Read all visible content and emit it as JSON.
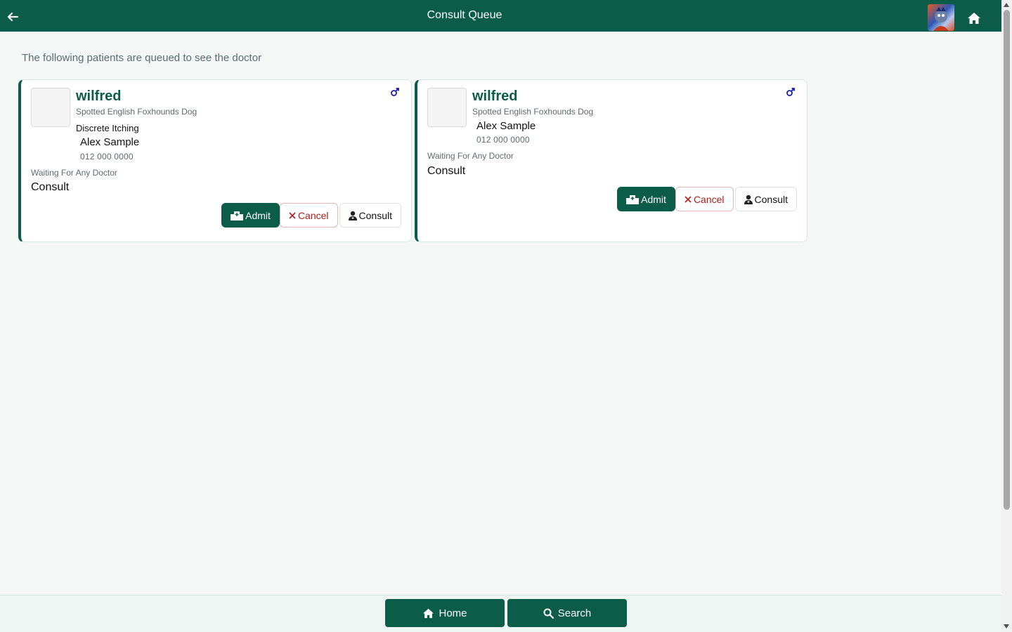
{
  "header": {
    "title": "Consult Queue"
  },
  "intro": "The following patients are queued to see the doctor",
  "cards": [
    {
      "pet_name": "wilfred",
      "breed": "Spotted English Foxhounds Dog",
      "complaint": "Discrete Itching",
      "owner": "Alex Sample",
      "phone": "012 000 0000",
      "waiting": "Waiting For Any Doctor",
      "consult_type": "Consult",
      "actions": {
        "admit": "Admit",
        "cancel": "Cancel",
        "consult": "Consult"
      }
    },
    {
      "pet_name": "wilfred",
      "breed": "Spotted English Foxhounds Dog",
      "complaint": "",
      "owner": "Alex Sample",
      "phone": "012 000 0000",
      "waiting": "Waiting For Any Doctor",
      "consult_type": "Consult",
      "actions": {
        "admit": "Admit",
        "cancel": "Cancel",
        "consult": "Consult"
      }
    }
  ],
  "bottom_nav": {
    "home": "Home",
    "search": "Search"
  },
  "colors": {
    "brand": "#0b5c48",
    "cancel": "#b01c1c",
    "male": "#1a1ab8"
  },
  "icons": [
    "back-arrow-icon",
    "home-icon",
    "male-icon",
    "hospital-icon",
    "close-icon",
    "doctor-icon",
    "search-icon"
  ]
}
